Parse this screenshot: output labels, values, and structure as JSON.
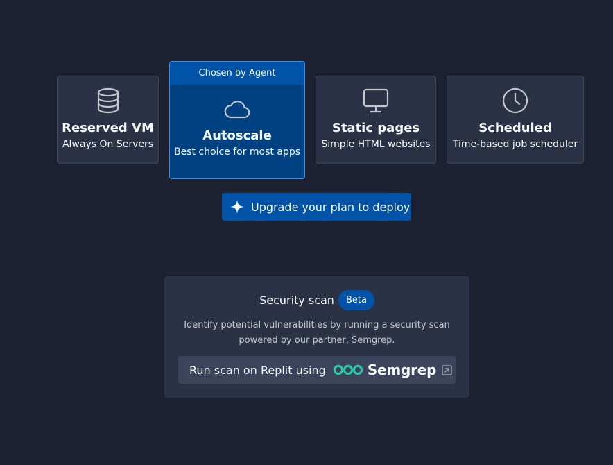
{
  "deployment_options": {
    "reserved_vm": {
      "title": "Reserved VM",
      "subtitle": "Always On Servers",
      "icon": "database-icon"
    },
    "autoscale": {
      "badge": "Chosen by Agent",
      "title": "Autoscale",
      "subtitle": "Best choice for most apps",
      "icon": "cloud-icon"
    },
    "static_pages": {
      "title": "Static pages",
      "subtitle": "Simple HTML websites",
      "icon": "monitor-icon"
    },
    "scheduled": {
      "title": "Scheduled",
      "subtitle": "Time-based job scheduler",
      "icon": "clock-icon"
    }
  },
  "upgrade_button": {
    "label": "Upgrade your plan to deploy",
    "icon": "sparkle-icon"
  },
  "security_scan": {
    "title": "Security scan",
    "badge": "Beta",
    "description": "Identify potential vulnerabilities by running a security scan powered by our partner, Semgrep.",
    "button_label": "Run scan on Replit using",
    "partner_name": "Semgrep",
    "partner_logo_icon": "semgrep-logo-icon",
    "external_icon": "external-link-icon"
  },
  "colors": {
    "background": "#1d2232",
    "card": "#2b3245",
    "selected_card": "#004182",
    "accent_blue": "#0053a6",
    "semgrep_green": "#2ec4a6"
  }
}
